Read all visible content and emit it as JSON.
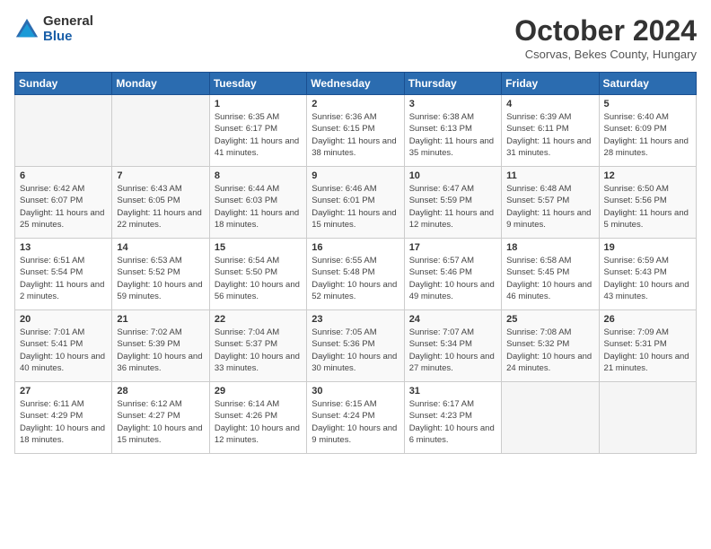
{
  "header": {
    "logo_general": "General",
    "logo_blue": "Blue",
    "month_title": "October 2024",
    "location": "Csorvas, Bekes County, Hungary"
  },
  "days_of_week": [
    "Sunday",
    "Monday",
    "Tuesday",
    "Wednesday",
    "Thursday",
    "Friday",
    "Saturday"
  ],
  "weeks": [
    [
      {
        "num": "",
        "info": ""
      },
      {
        "num": "",
        "info": ""
      },
      {
        "num": "1",
        "info": "Sunrise: 6:35 AM\nSunset: 6:17 PM\nDaylight: 11 hours and 41 minutes."
      },
      {
        "num": "2",
        "info": "Sunrise: 6:36 AM\nSunset: 6:15 PM\nDaylight: 11 hours and 38 minutes."
      },
      {
        "num": "3",
        "info": "Sunrise: 6:38 AM\nSunset: 6:13 PM\nDaylight: 11 hours and 35 minutes."
      },
      {
        "num": "4",
        "info": "Sunrise: 6:39 AM\nSunset: 6:11 PM\nDaylight: 11 hours and 31 minutes."
      },
      {
        "num": "5",
        "info": "Sunrise: 6:40 AM\nSunset: 6:09 PM\nDaylight: 11 hours and 28 minutes."
      }
    ],
    [
      {
        "num": "6",
        "info": "Sunrise: 6:42 AM\nSunset: 6:07 PM\nDaylight: 11 hours and 25 minutes."
      },
      {
        "num": "7",
        "info": "Sunrise: 6:43 AM\nSunset: 6:05 PM\nDaylight: 11 hours and 22 minutes."
      },
      {
        "num": "8",
        "info": "Sunrise: 6:44 AM\nSunset: 6:03 PM\nDaylight: 11 hours and 18 minutes."
      },
      {
        "num": "9",
        "info": "Sunrise: 6:46 AM\nSunset: 6:01 PM\nDaylight: 11 hours and 15 minutes."
      },
      {
        "num": "10",
        "info": "Sunrise: 6:47 AM\nSunset: 5:59 PM\nDaylight: 11 hours and 12 minutes."
      },
      {
        "num": "11",
        "info": "Sunrise: 6:48 AM\nSunset: 5:57 PM\nDaylight: 11 hours and 9 minutes."
      },
      {
        "num": "12",
        "info": "Sunrise: 6:50 AM\nSunset: 5:56 PM\nDaylight: 11 hours and 5 minutes."
      }
    ],
    [
      {
        "num": "13",
        "info": "Sunrise: 6:51 AM\nSunset: 5:54 PM\nDaylight: 11 hours and 2 minutes."
      },
      {
        "num": "14",
        "info": "Sunrise: 6:53 AM\nSunset: 5:52 PM\nDaylight: 10 hours and 59 minutes."
      },
      {
        "num": "15",
        "info": "Sunrise: 6:54 AM\nSunset: 5:50 PM\nDaylight: 10 hours and 56 minutes."
      },
      {
        "num": "16",
        "info": "Sunrise: 6:55 AM\nSunset: 5:48 PM\nDaylight: 10 hours and 52 minutes."
      },
      {
        "num": "17",
        "info": "Sunrise: 6:57 AM\nSunset: 5:46 PM\nDaylight: 10 hours and 49 minutes."
      },
      {
        "num": "18",
        "info": "Sunrise: 6:58 AM\nSunset: 5:45 PM\nDaylight: 10 hours and 46 minutes."
      },
      {
        "num": "19",
        "info": "Sunrise: 6:59 AM\nSunset: 5:43 PM\nDaylight: 10 hours and 43 minutes."
      }
    ],
    [
      {
        "num": "20",
        "info": "Sunrise: 7:01 AM\nSunset: 5:41 PM\nDaylight: 10 hours and 40 minutes."
      },
      {
        "num": "21",
        "info": "Sunrise: 7:02 AM\nSunset: 5:39 PM\nDaylight: 10 hours and 36 minutes."
      },
      {
        "num": "22",
        "info": "Sunrise: 7:04 AM\nSunset: 5:37 PM\nDaylight: 10 hours and 33 minutes."
      },
      {
        "num": "23",
        "info": "Sunrise: 7:05 AM\nSunset: 5:36 PM\nDaylight: 10 hours and 30 minutes."
      },
      {
        "num": "24",
        "info": "Sunrise: 7:07 AM\nSunset: 5:34 PM\nDaylight: 10 hours and 27 minutes."
      },
      {
        "num": "25",
        "info": "Sunrise: 7:08 AM\nSunset: 5:32 PM\nDaylight: 10 hours and 24 minutes."
      },
      {
        "num": "26",
        "info": "Sunrise: 7:09 AM\nSunset: 5:31 PM\nDaylight: 10 hours and 21 minutes."
      }
    ],
    [
      {
        "num": "27",
        "info": "Sunrise: 6:11 AM\nSunset: 4:29 PM\nDaylight: 10 hours and 18 minutes."
      },
      {
        "num": "28",
        "info": "Sunrise: 6:12 AM\nSunset: 4:27 PM\nDaylight: 10 hours and 15 minutes."
      },
      {
        "num": "29",
        "info": "Sunrise: 6:14 AM\nSunset: 4:26 PM\nDaylight: 10 hours and 12 minutes."
      },
      {
        "num": "30",
        "info": "Sunrise: 6:15 AM\nSunset: 4:24 PM\nDaylight: 10 hours and 9 minutes."
      },
      {
        "num": "31",
        "info": "Sunrise: 6:17 AM\nSunset: 4:23 PM\nDaylight: 10 hours and 6 minutes."
      },
      {
        "num": "",
        "info": ""
      },
      {
        "num": "",
        "info": ""
      }
    ]
  ]
}
